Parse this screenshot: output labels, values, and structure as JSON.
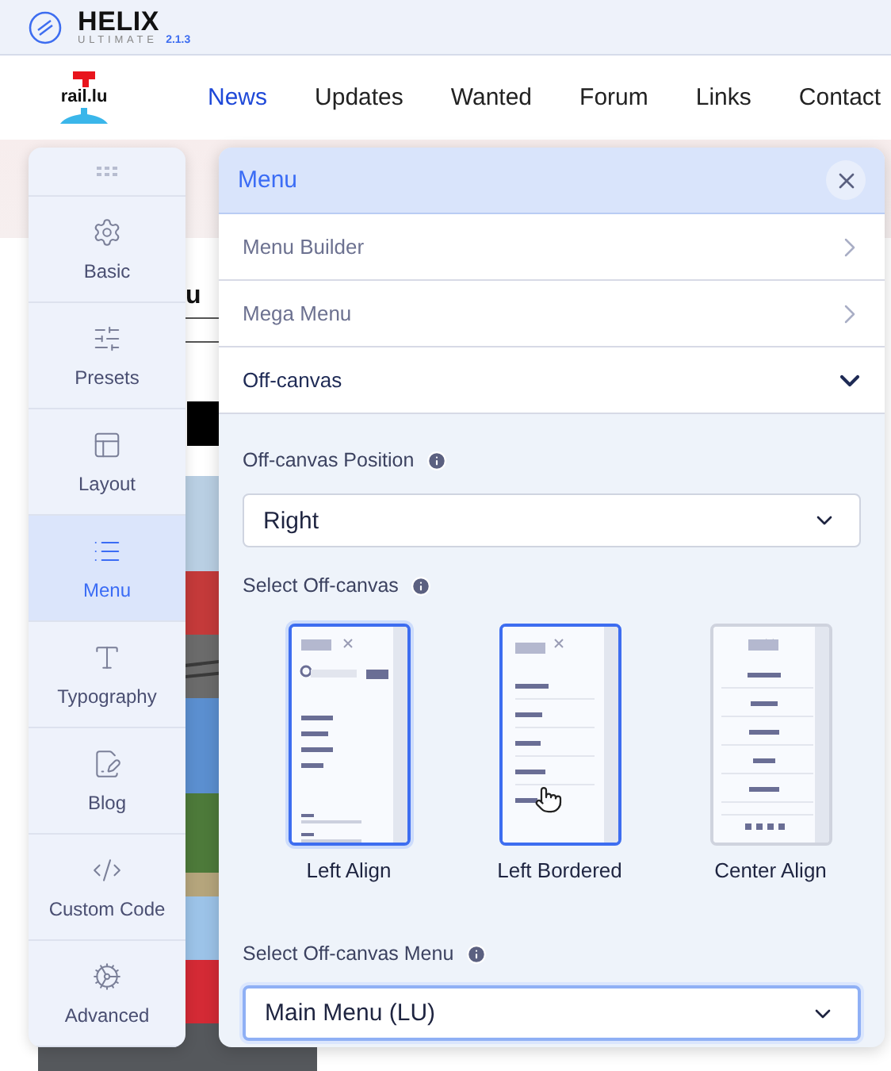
{
  "header": {
    "brand": "HELIX",
    "subtitle": "ULTIMATE",
    "version": "2.1.3"
  },
  "site": {
    "logo_text": "rail.lu",
    "nav": [
      {
        "label": "News",
        "selected": true
      },
      {
        "label": "Updates",
        "selected": false
      },
      {
        "label": "Wanted",
        "selected": false
      },
      {
        "label": "Forum",
        "selected": false
      },
      {
        "label": "Links",
        "selected": false
      },
      {
        "label": "Contact",
        "selected": false
      }
    ],
    "heading_fragment": "u"
  },
  "sidebar": {
    "items": [
      {
        "label": "Basic",
        "selected": false
      },
      {
        "label": "Presets",
        "selected": false
      },
      {
        "label": "Layout",
        "selected": false
      },
      {
        "label": "Menu",
        "selected": true
      },
      {
        "label": "Typography",
        "selected": false
      },
      {
        "label": "Blog",
        "selected": false
      },
      {
        "label": "Custom Code",
        "selected": false
      },
      {
        "label": "Advanced",
        "selected": false
      }
    ]
  },
  "panel": {
    "title": "Menu",
    "sections": [
      {
        "label": "Menu Builder",
        "expanded": false
      },
      {
        "label": "Mega Menu",
        "expanded": false
      },
      {
        "label": "Off-canvas",
        "expanded": true
      }
    ],
    "position": {
      "label": "Off-canvas Position",
      "value": "Right"
    },
    "offcanvas": {
      "label": "Select Off-canvas",
      "options": [
        {
          "label": "Left Align",
          "kind": "left",
          "selected": true,
          "hovered": false
        },
        {
          "label": "Left Bordered",
          "kind": "bordered",
          "selected": false,
          "hovered": true
        },
        {
          "label": "Center Align",
          "kind": "center",
          "selected": false,
          "hovered": false
        }
      ]
    },
    "menu_select": {
      "label": "Select Off-canvas Menu",
      "value": "Main Menu (LU)",
      "focused": true
    }
  }
}
